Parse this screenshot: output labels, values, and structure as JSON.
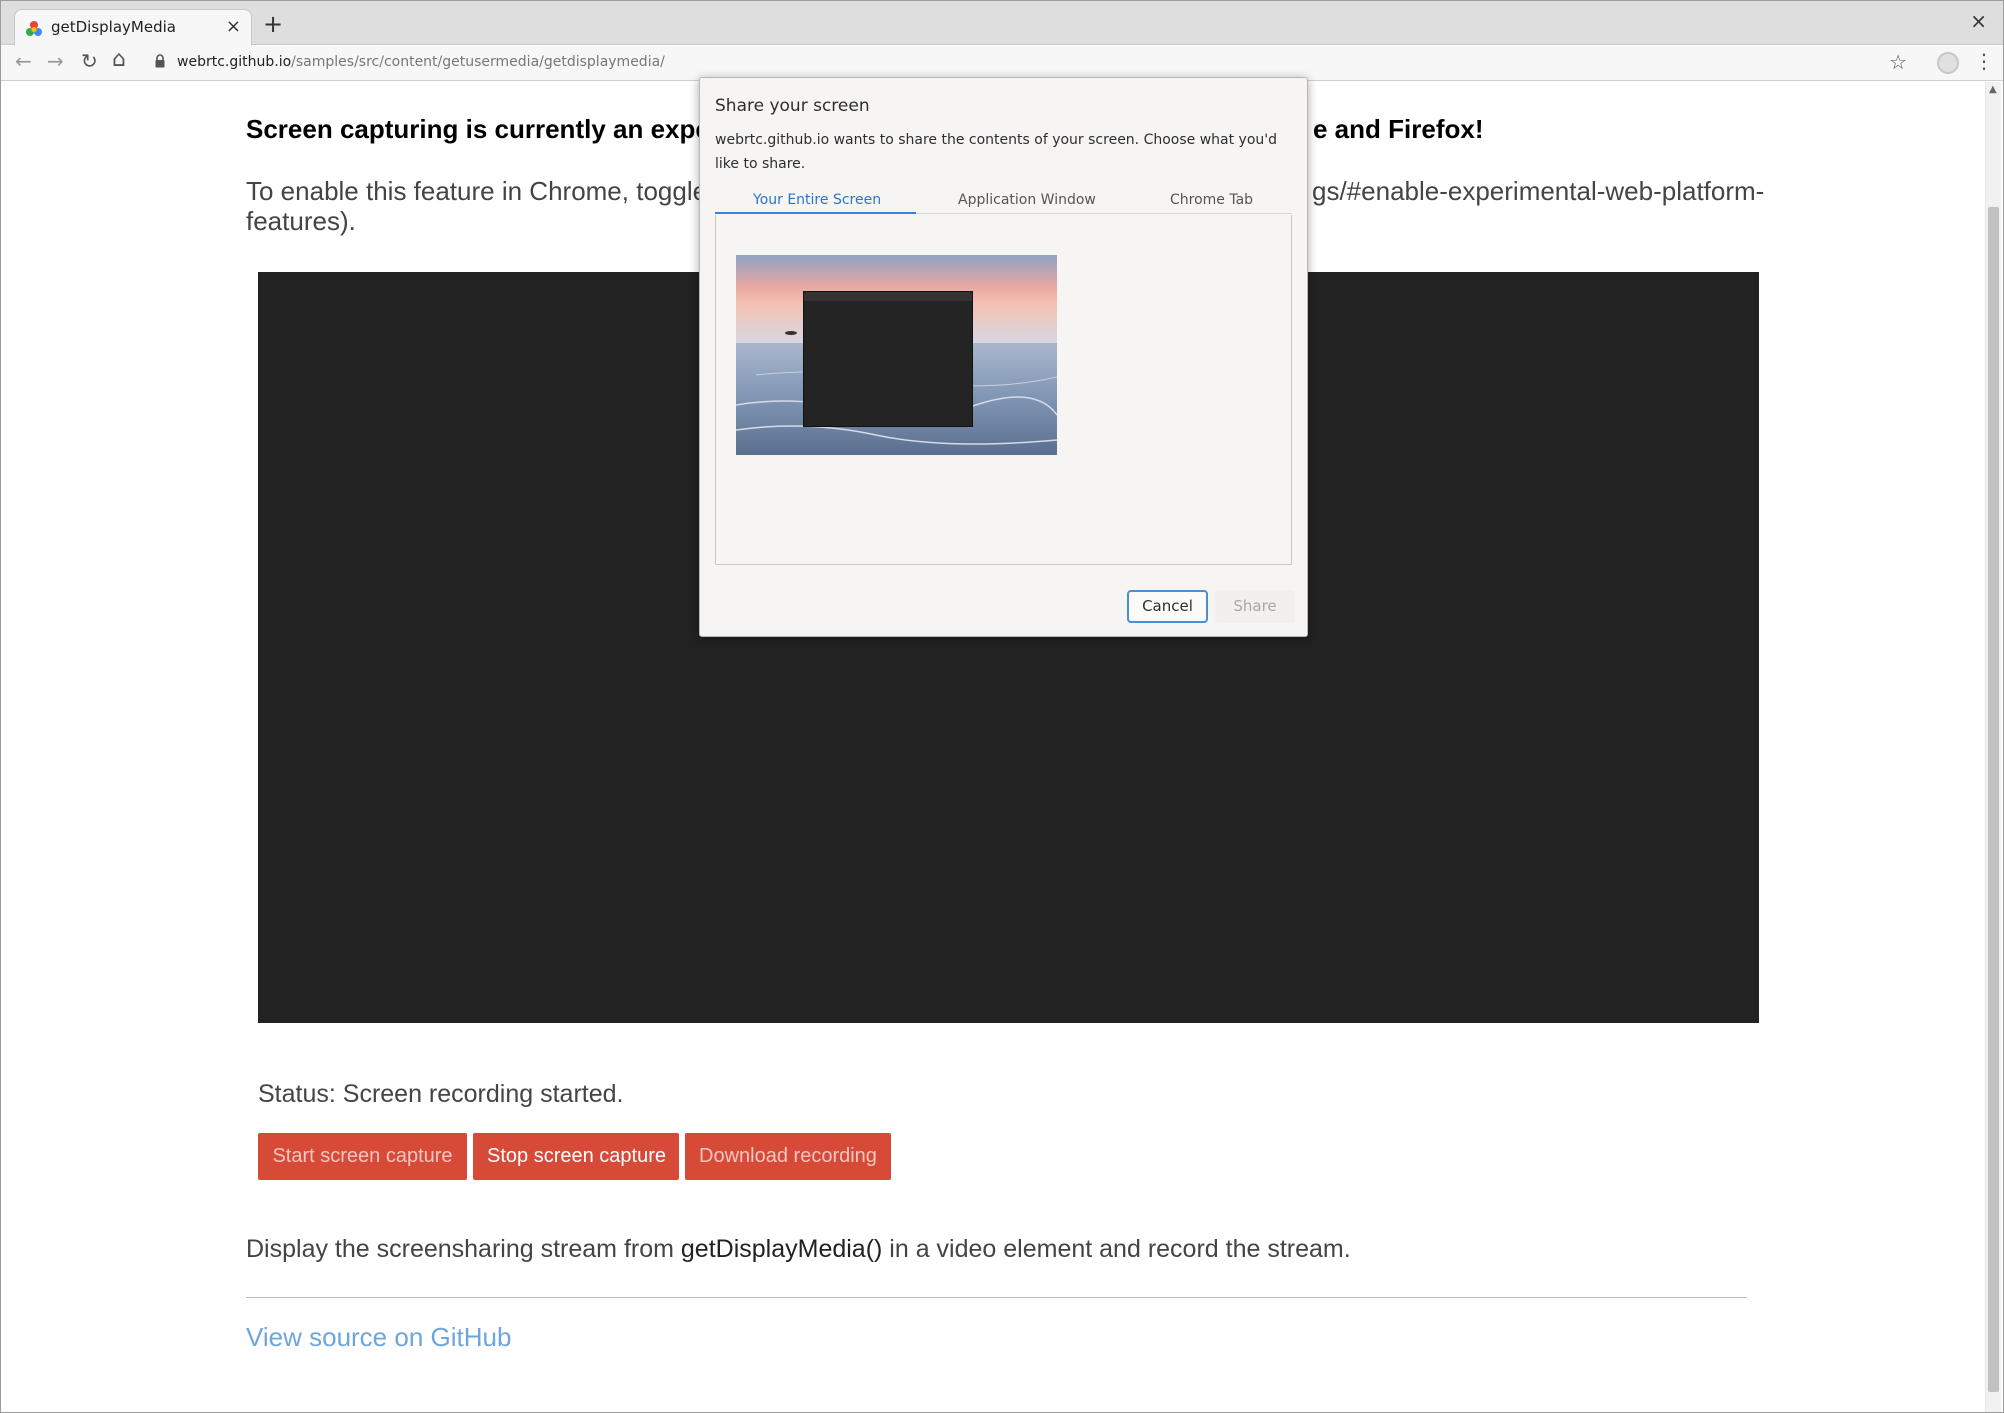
{
  "browser": {
    "tab_title": "getDisplayMedia",
    "tab_close": "×",
    "new_tab": "+",
    "window_close": "×",
    "url_host": "webrtc.github.io",
    "url_path": "/samples/src/content/getusermedia/getdisplaymedia/",
    "back_icon": "←",
    "forward_icon": "→",
    "reload_icon": "↻",
    "home_icon": "⌂",
    "bookmark_icon": "☆",
    "menu_icon": "⋮"
  },
  "page": {
    "heading_start": "Screen capturing is currently an experim",
    "heading_end": "e and Firefox!",
    "enable_start": "To enable this feature in Chrome, toggle th",
    "enable_end": "gs/#enable-experimental-web-platform-",
    "enable_line2": "features).",
    "status": "Status: Screen recording started.",
    "buttons": {
      "start": "Start screen capture",
      "stop": "Stop screen capture",
      "download": "Download recording"
    },
    "desc_before": "Display the screensharing stream from ",
    "desc_code": "getDisplayMedia()",
    "desc_after": " in a video element and record the stream.",
    "source_link": "View source on GitHub"
  },
  "dialog": {
    "title": "Share your screen",
    "message": "webrtc.github.io wants to share the contents of your screen. Choose what you'd like to share.",
    "tabs": [
      "Your Entire Screen",
      "Application Window",
      "Chrome Tab"
    ],
    "cancel": "Cancel",
    "share": "Share"
  },
  "colors": {
    "button_red": "#d84a38",
    "link_blue": "#6ea6dc",
    "dialog_accent": "#3584e4"
  }
}
